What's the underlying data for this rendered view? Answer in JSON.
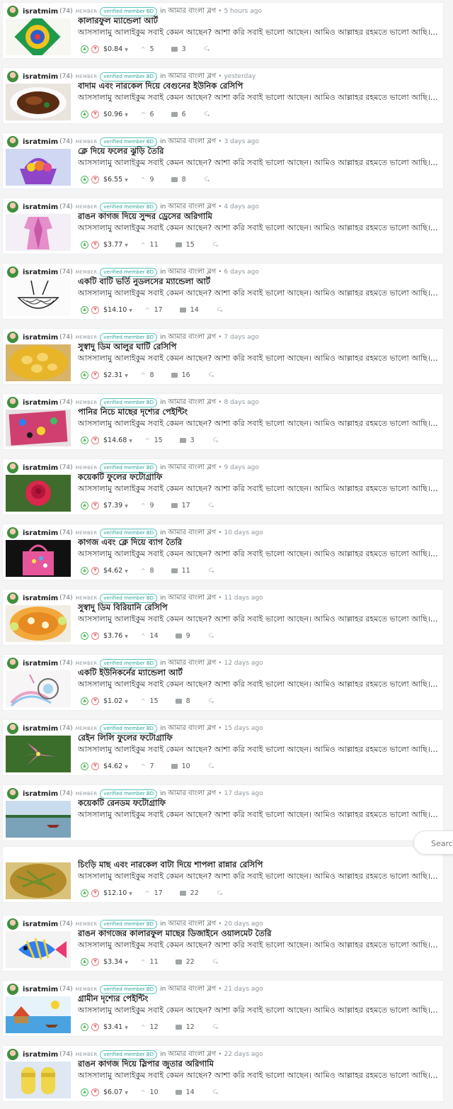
{
  "feed": {
    "author": "isratmim",
    "reputation": "(74)",
    "role": "MEMBER",
    "badge": "verified member BD",
    "in_label": "in",
    "community": "আমার বাংলা ব্লগ",
    "excerpt": "আসসালামু আলাইকুম সবাই কেমন আছেন? আশা করি সবাই ভালো আছেন। আমিও আল্লাহর রহমতে ভালো আছি। আজ...",
    "posts": [
      {
        "time": "5 hours ago",
        "title": "কালারফুল ম্যান্ডেলা আর্ট",
        "payout": "$0.84",
        "votes": "5",
        "replies": "3",
        "thumb": "mandala"
      },
      {
        "time": "yesterday",
        "title": "বাদাম এবং নারকেল দিয়ে বেগুনের ইউনিক রেসিপি",
        "payout": "$0.96",
        "votes": "6",
        "replies": "6",
        "thumb": "curry-dark"
      },
      {
        "time": "3 days ago",
        "title": "ক্লে দিয়ে ফলের ঝুড়ি তৈরি",
        "payout": "$6.55",
        "votes": "9",
        "replies": "8",
        "thumb": "clay-basket"
      },
      {
        "time": "4 days ago",
        "title": "রাঙন কাগজ দিয়ে সুন্দর ড্রেসের অরিগামি",
        "payout": "$3.77",
        "votes": "11",
        "replies": "15",
        "thumb": "origami-dress"
      },
      {
        "time": "6 days ago",
        "title": "একটি বাটি ভর্তি নুডলসের ম্যান্ডেলা আর্ট",
        "payout": "$14.10",
        "votes": "17",
        "replies": "14",
        "thumb": "noodle-sketch"
      },
      {
        "time": "7 days ago",
        "title": "সুস্বাদু ডিম আলুর ঘাটি রেসিপি",
        "payout": "$2.31",
        "votes": "8",
        "replies": "16",
        "thumb": "egg-curry"
      },
      {
        "time": "8 days ago",
        "title": "পানির নিচে মাছের দৃশ্যের পেইন্টিং",
        "payout": "$14.68",
        "votes": "15",
        "replies": "3",
        "thumb": "fish-painting"
      },
      {
        "time": "9 days ago",
        "title": "কয়েকটি ফুলের ফটোগ্রাফি",
        "payout": "$7.39",
        "votes": "9",
        "replies": "17",
        "thumb": "red-rose"
      },
      {
        "time": "10 days ago",
        "title": "কাগজ এবং ক্লে দিয়ে ব্যাগ তৈরি",
        "payout": "$4.62",
        "votes": "8",
        "replies": "11",
        "thumb": "pink-bag"
      },
      {
        "time": "11 days ago",
        "title": "সুস্বাদু ডিম বিরিয়ানি রেসিপি",
        "payout": "$3.76",
        "votes": "14",
        "replies": "9",
        "thumb": "biryani"
      },
      {
        "time": "12 days ago",
        "title": "একটি ইউনিকর্নের ম্যান্ডেলা আর্ট",
        "payout": "$1.02",
        "votes": "15",
        "replies": "8",
        "thumb": "unicorn"
      },
      {
        "time": "15 days ago",
        "title": "রেইন লিলি ফুলের ফটোগ্রাফি",
        "payout": "$4.62",
        "votes": "7",
        "replies": "10",
        "thumb": "pink-lily"
      },
      {
        "time": "17 days ago",
        "title": "কয়েকটি রেনডম ফটোগ্রাফি",
        "payout": "",
        "votes": "",
        "replies": "",
        "thumb": "river-boat"
      },
      {
        "time": "",
        "title": "চিংড়ি মাছ এবং নারকেল বাটা দিয়ে শাপলা রান্নার রেসিপি",
        "payout": "$12.10",
        "votes": "17",
        "replies": "22",
        "thumb": "shapla-curry"
      },
      {
        "time": "20 days ago",
        "title": "রাঙন কাগজের কালারফুল মাছের ডিজাইনে ওয়ালমেট তৈরি",
        "payout": "$3.34",
        "votes": "11",
        "replies": "22",
        "thumb": "paper-fish"
      },
      {
        "time": "21 days ago",
        "title": "গ্রামীন দৃশ্যের পেইন্টিং",
        "payout": "$3.41",
        "votes": "12",
        "replies": "12",
        "thumb": "village-painting"
      },
      {
        "time": "22 days ago",
        "title": "রাঙন কাগজ দিয়ে স্লিপার জুতার অরিগামি",
        "payout": "$6.07",
        "votes": "10",
        "replies": "14",
        "thumb": "yellow-slippers"
      }
    ]
  },
  "search": {
    "placeholder": "Search"
  },
  "colors": {
    "upvote": "#4fb85f",
    "downvote": "#e37b7b",
    "badge": "#2aa69b"
  }
}
